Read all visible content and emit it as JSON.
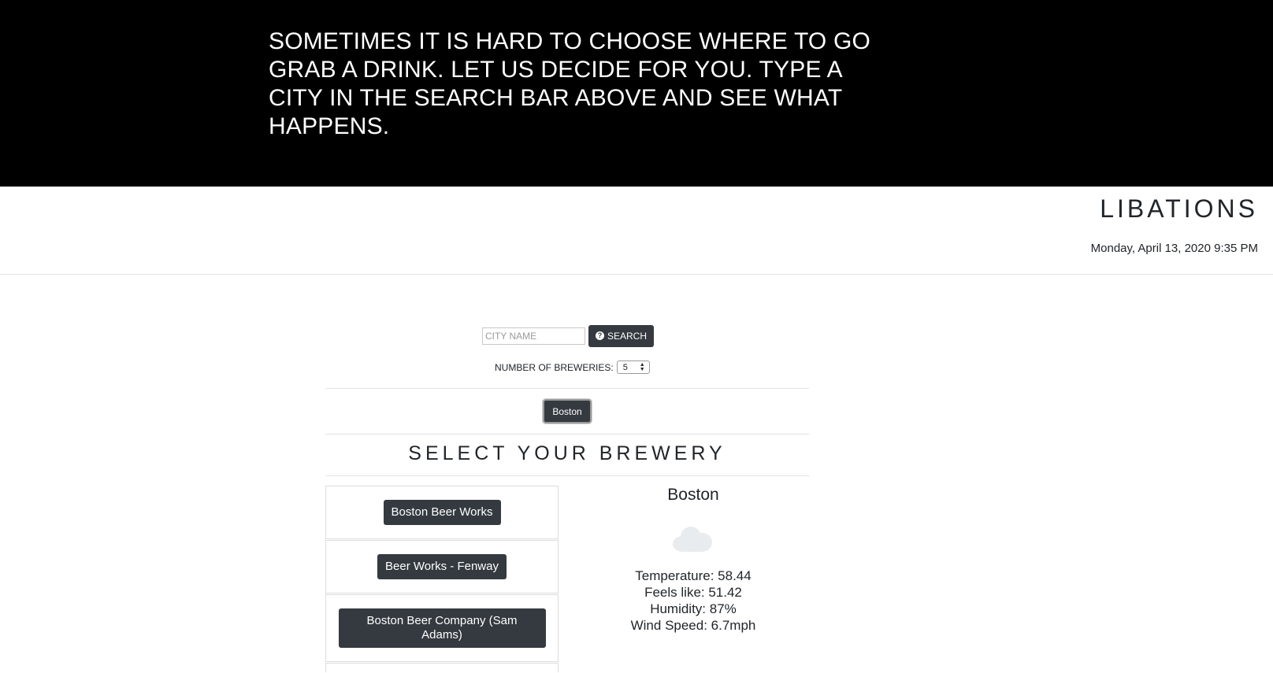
{
  "hero": {
    "text": "SOMETIMES IT IS HARD TO CHOOSE WHERE TO GO GRAB A DRINK. LET US DECIDE FOR YOU. TYPE A CITY IN THE SEARCH BAR ABOVE AND SEE WHAT HAPPENS."
  },
  "header": {
    "brand": "LIBATIONS",
    "datetime": "Monday, April 13, 2020 9:35 PM"
  },
  "search": {
    "placeholder": "CITY NAME",
    "value": "",
    "button_label": "SEARCH",
    "button_icon": "question-circle-icon"
  },
  "breweries_count": {
    "label": "NUMBER OF BREWERIES:",
    "selected": "5"
  },
  "history": {
    "cities": [
      "Boston"
    ]
  },
  "brewery_section": {
    "title": "SELECT YOUR BREWERY",
    "items": [
      {
        "label": "Boston Beer Works"
      },
      {
        "label": "Beer Works - Fenway"
      },
      {
        "label": "Boston Beer Company (Sam Adams)"
      }
    ]
  },
  "weather": {
    "city": "Boston",
    "icon": "cloud-icon",
    "temperature": "Temperature: 58.44",
    "feels_like": "Feels like: 51.42",
    "humidity": "Humidity: 87%",
    "wind_speed": "Wind Speed: 6.7mph"
  },
  "colors": {
    "hero_bg": "#000000",
    "button_bg": "#343a40",
    "text": "#212529"
  }
}
